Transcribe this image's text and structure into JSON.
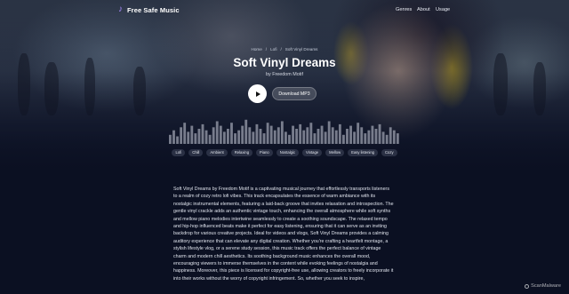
{
  "nav": {
    "brand": "Free Safe Music",
    "brand_icon": "music-note-icon",
    "links": [
      "Genres",
      "About",
      "Usage"
    ]
  },
  "track": {
    "breadcrumb": [
      "Home",
      "Lofi",
      "Soft Vinyl Dreams"
    ],
    "breadcrumb_separator": "/",
    "title": "Soft Vinyl Dreams",
    "artist": "by Freedom Motif",
    "play_icon": "play-icon",
    "download_label": "Download MP3",
    "waveform_levels": [
      0.3,
      0.45,
      0.25,
      0.55,
      0.7,
      0.4,
      0.6,
      0.35,
      0.5,
      0.65,
      0.45,
      0.3,
      0.55,
      0.75,
      0.6,
      0.4,
      0.5,
      0.7,
      0.35,
      0.45,
      0.6,
      0.8,
      0.55,
      0.4,
      0.65,
      0.5,
      0.35,
      0.7,
      0.6,
      0.45,
      0.55,
      0.75,
      0.4,
      0.3,
      0.6,
      0.5,
      0.65,
      0.45,
      0.55,
      0.7,
      0.35,
      0.5,
      0.6,
      0.4,
      0.75,
      0.55,
      0.45,
      0.65,
      0.3,
      0.5,
      0.6,
      0.4,
      0.7,
      0.55,
      0.35,
      0.45,
      0.6,
      0.5,
      0.65,
      0.4,
      0.3,
      0.55,
      0.45,
      0.35
    ]
  },
  "tags": [
    "Lofi",
    "Chill",
    "Ambient",
    "Relaxing",
    "Piano",
    "Nostalgic",
    "Vintage",
    "Mellow",
    "Easy listening",
    "Cozy"
  ],
  "description": "Soft Vinyl Dreams by Freedom Motif is a captivating musical journey that effortlessly transports listeners to a realm of cozy retro lofi vibes. This track encapsulates the essence of warm ambiance with its nostalgic instrumental elements, featuring a laid-back groove that invites relaxation and introspection. The gentle vinyl crackle adds an authentic vintage touch, enhancing the overall atmosphere while soft synths and mellow piano melodies intertwine seamlessly to create a soothing soundscape. The relaxed tempo and hip-hop influenced beats make it perfect for easy listening, ensuring that it can serve as an inviting backdrop for various creative projects. Ideal for videos and vlogs, Soft Vinyl Dreams provides a calming auditory experience that can elevate any digital creation. Whether you're crafting a heartfelt montage, a stylish lifestyle vlog, or a serene study session, this music track offers the perfect balance of vintage charm and modern chill aesthetics. Its soothing background music enhances the overall mood, encouraging viewers to immerse themselves in the content while evoking feelings of nostalgia and happiness. Moreover, this piece is licensed for copyright-free use, allowing creators to freely incorporate it into their works without the worry of copyright infringement. So, whether you seek to inspire,",
  "watermark": "ScanMalware",
  "colors": {
    "background": "#0b1022",
    "accent": "#a98bff",
    "tag_bg": "#2a3044"
  }
}
